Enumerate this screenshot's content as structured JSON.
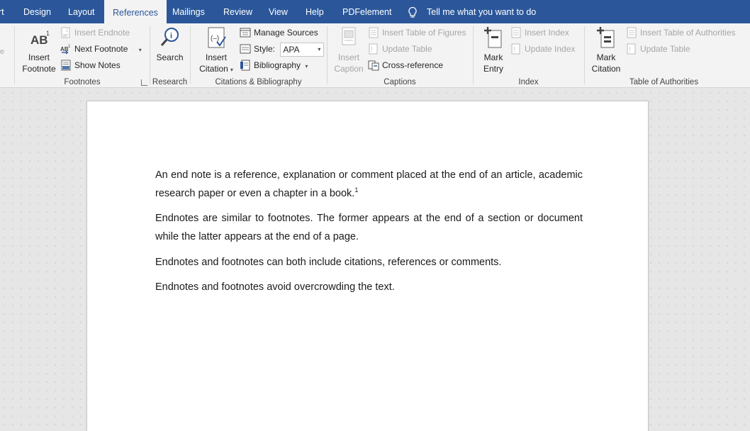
{
  "tabs": {
    "items": [
      {
        "label": "rt"
      },
      {
        "label": "Design"
      },
      {
        "label": "Layout"
      },
      {
        "label": "References"
      },
      {
        "label": "Mailings"
      },
      {
        "label": "Review"
      },
      {
        "label": "View"
      },
      {
        "label": "Help"
      },
      {
        "label": "PDFelement"
      }
    ],
    "tell_me": "Tell me what you want to do"
  },
  "ribbon": {
    "footnotes": {
      "insert_footnote": [
        "Insert",
        "Footnote"
      ],
      "insert_endnote": "Insert Endnote",
      "next_footnote": "Next Footnote",
      "show_notes": "Show Notes",
      "group_label": "Footnotes"
    },
    "research": {
      "search": "Search",
      "group_label": "Research"
    },
    "citations": {
      "insert_citation": [
        "Insert",
        "Citation"
      ],
      "manage_sources": "Manage Sources",
      "style_label": "Style:",
      "style_value": "APA",
      "bibliography": "Bibliography",
      "group_label": "Citations & Bibliography"
    },
    "captions": {
      "insert_caption": [
        "Insert",
        "Caption"
      ],
      "insert_table_of_figures": "Insert Table of Figures",
      "update_table": "Update Table",
      "cross_reference": "Cross-reference",
      "group_label": "Captions"
    },
    "index": {
      "mark_entry": [
        "Mark",
        "Entry"
      ],
      "insert_index": "Insert Index",
      "update_index": "Update Index",
      "group_label": "Index"
    },
    "authorities": {
      "mark_citation": [
        "Mark",
        "Citation"
      ],
      "insert_table_of_authorities": "Insert Table of Authorities",
      "update_table": "Update Table",
      "group_label": "Table of Authorities"
    }
  },
  "document": {
    "p1_text": "An end note is a reference, explanation or comment placed at the end of an article, academic research paper or even a chapter in a book.",
    "p1_sup": "1",
    "p2": "Endnotes are similar to footnotes. The former appears at the end of a section or document while the latter appears at the end of a page.",
    "p3": "Endnotes and footnotes can both include citations, references or comments.",
    "p4": "Endnotes and footnotes avoid overcrowding the text."
  },
  "colors": {
    "tabbar": "#2b579a",
    "ribbon": "#f3f3f3",
    "canvas": "#e6e6e6"
  }
}
